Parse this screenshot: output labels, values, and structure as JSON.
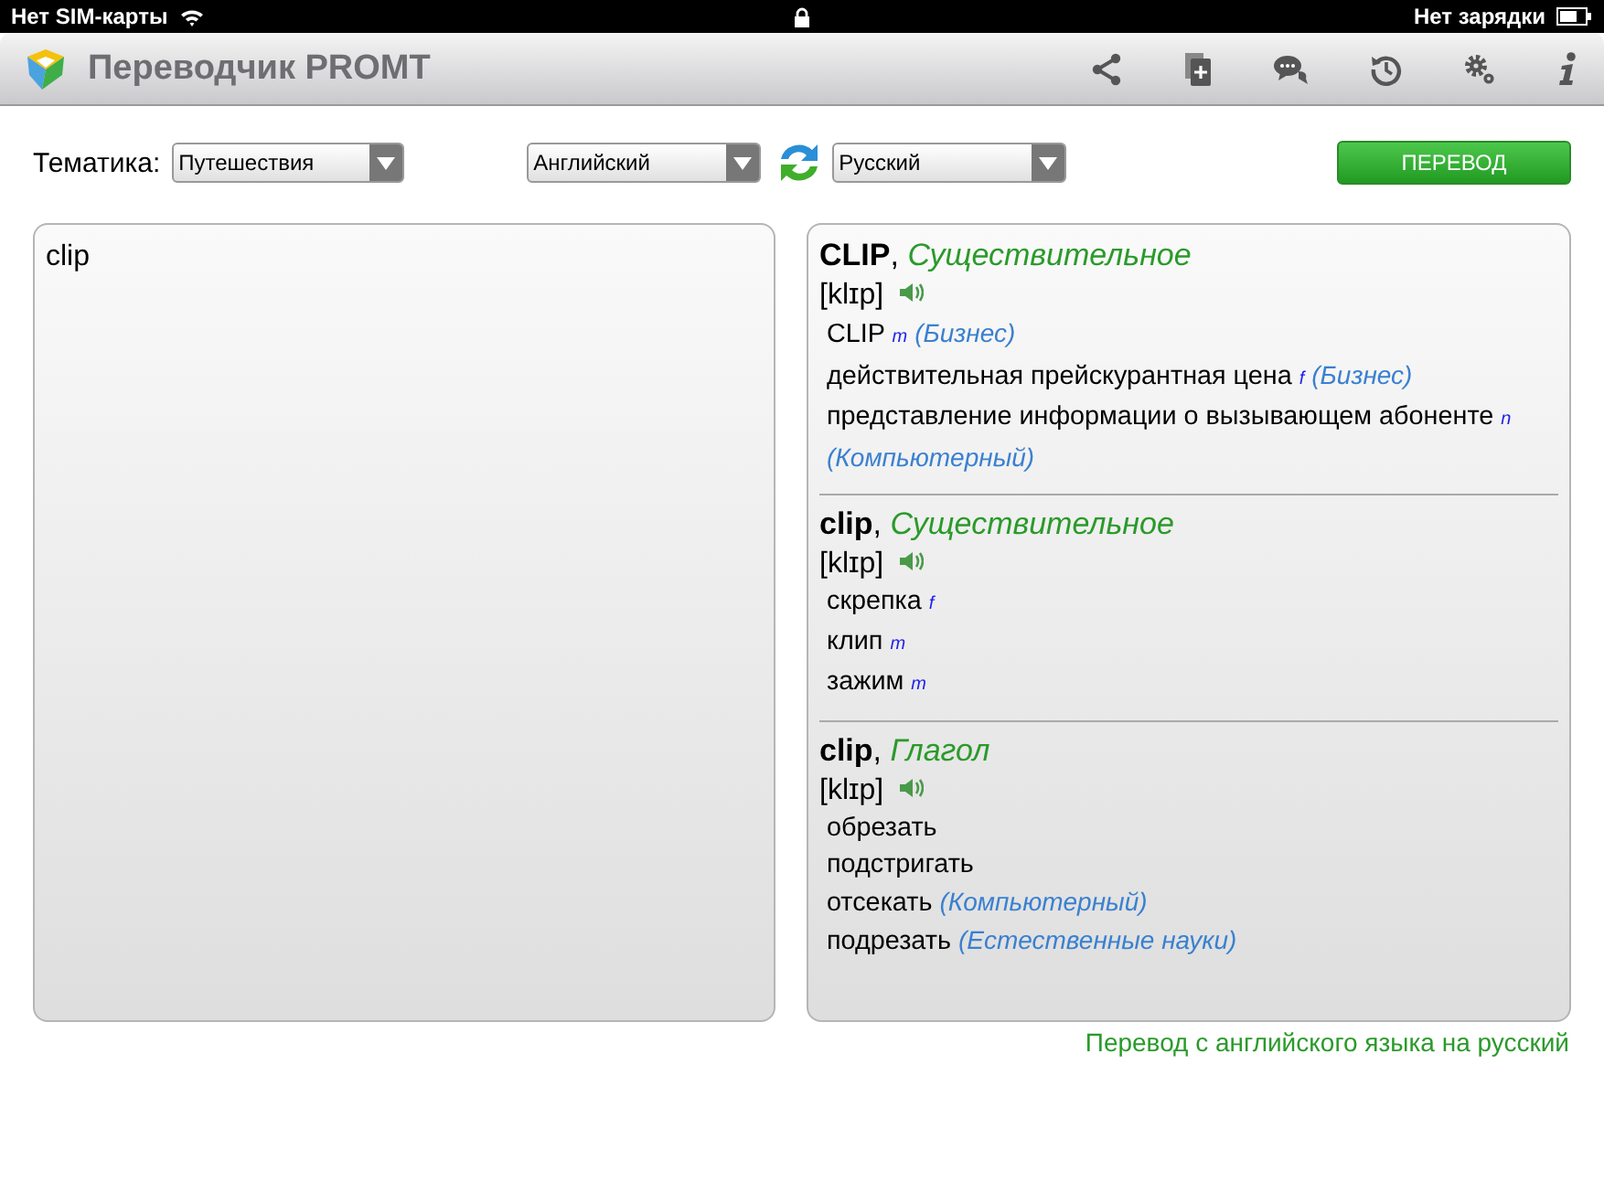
{
  "status_bar": {
    "carrier": "Нет SIM-карты",
    "charging": "Нет зарядки"
  },
  "app": {
    "title": "Переводчик PROMT",
    "toolbar": [
      {
        "kind": "share"
      },
      {
        "kind": "new"
      },
      {
        "kind": "chat"
      },
      {
        "kind": "history"
      },
      {
        "kind": "settings"
      },
      {
        "kind": "info"
      }
    ]
  },
  "controls": {
    "topic_label": "Тематика:",
    "topic": "Путешествия",
    "source_language": "Английский",
    "target_language": "Русский",
    "translate_button": "ПЕРЕВОД"
  },
  "input": {
    "value": "clip"
  },
  "entries": [
    {
      "heading": "**CLIP**, *Существительное*",
      "transcription": "[klɪp]",
      "meanings": [
        {
          "text": "CLIP",
          "gender": "m",
          "domain": "(Бизнес)"
        },
        {
          "text": "действительная прейскурантная цена",
          "gender": "f",
          "domain": "(Бизнес)"
        },
        {
          "text": "представление информации о вызывающем абоненте",
          "gender": "n",
          "domain": "(Компьютерный)"
        }
      ]
    },
    {
      "heading": "**clip**, *Существительное*",
      "transcription": "[klɪp]",
      "meanings": [
        {
          "text": "скрепка",
          "gender": "f"
        },
        {
          "text": "клип",
          "gender": "m"
        },
        {
          "text": "зажим",
          "gender": "m"
        }
      ]
    },
    {
      "heading": "**clip**, *Глагол*",
      "transcription": "[klɪp]",
      "meanings": [
        {
          "text": "обрезать"
        },
        {
          "text": "подстригать"
        },
        {
          "text": "отсекать",
          "domain": "(Компьютерный)"
        },
        {
          "text": "подрезать",
          "domain": "(Естественные науки)"
        }
      ]
    }
  ],
  "direction_note": "Перевод с английского языка на русский"
}
